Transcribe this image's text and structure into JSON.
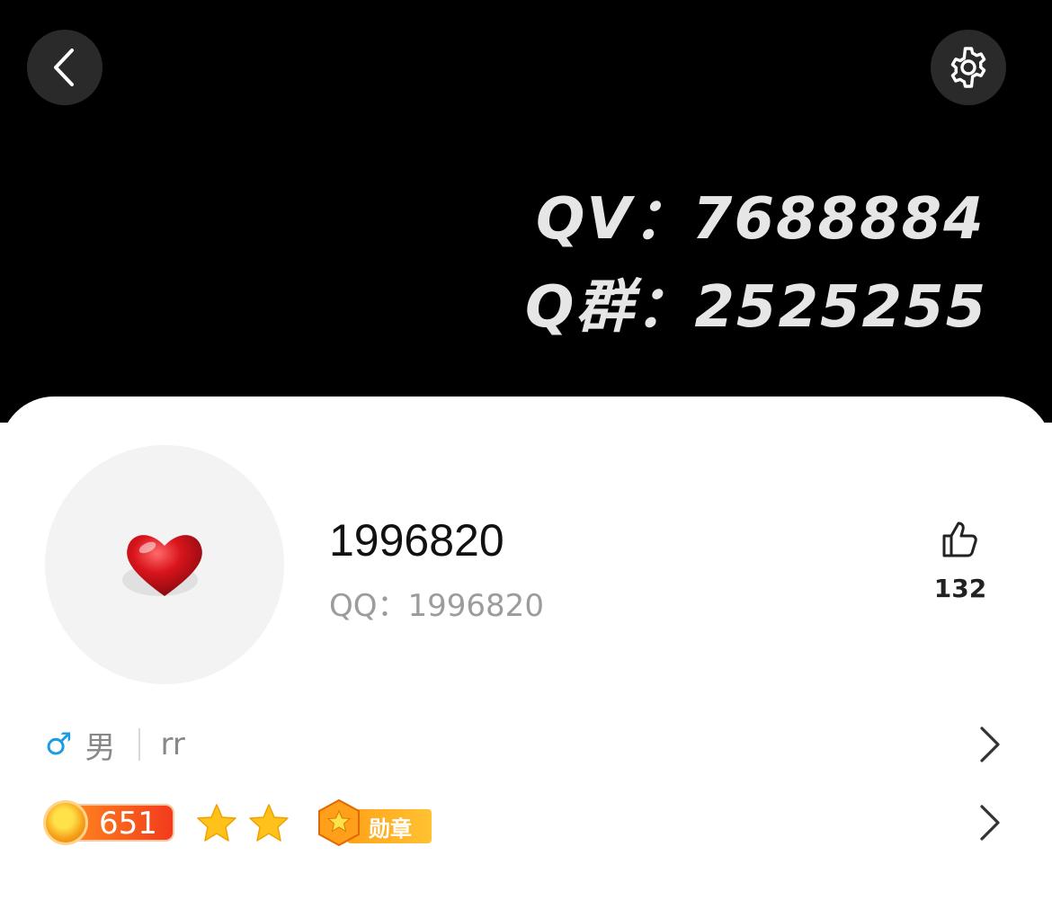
{
  "header": {
    "cover_line_1": "QV：7688884",
    "cover_line_2": "Q群：2525255"
  },
  "profile": {
    "nickname": "1996820",
    "qq_label": "QQ：1996820",
    "likes": "132"
  },
  "info": {
    "gender_symbol": "♂",
    "gender": "男",
    "signature": "rr"
  },
  "badges": {
    "level": "651",
    "stars": 2,
    "medal_label": "勋章"
  },
  "icons": {
    "back": "chevron-left-icon",
    "settings": "gear-icon",
    "like": "thumbs-up-icon",
    "row_arrow": "chevron-right-icon"
  },
  "colors": {
    "header_bg": "#000000",
    "gender_male": "#1a9be6",
    "level_orange": "#f23b1d",
    "medal_orange": "#ffa21a"
  }
}
